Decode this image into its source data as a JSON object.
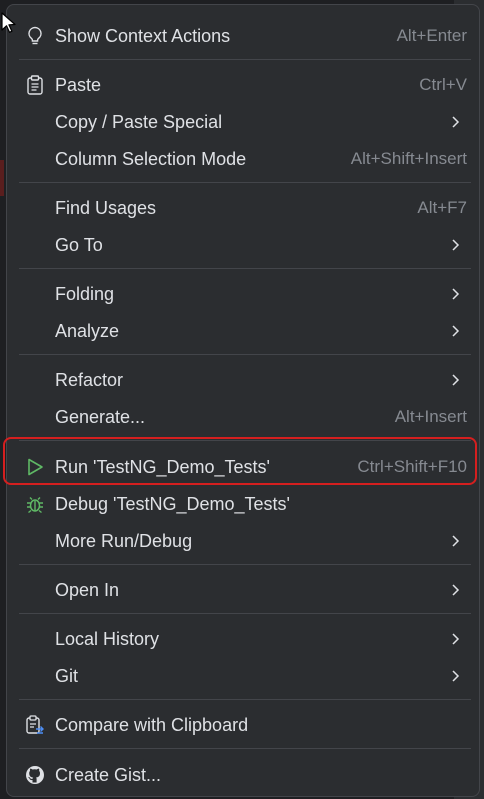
{
  "menu": {
    "items": [
      {
        "label": "Show Context Actions",
        "shortcut": "Alt+Enter",
        "icon": "lightbulb-icon"
      },
      {
        "label": "Paste",
        "shortcut": "Ctrl+V",
        "icon": "clipboard-icon"
      },
      {
        "label": "Copy / Paste Special",
        "submenu": true
      },
      {
        "label": "Column Selection Mode",
        "shortcut": "Alt+Shift+Insert"
      },
      {
        "label": "Find Usages",
        "shortcut": "Alt+F7"
      },
      {
        "label": "Go To",
        "submenu": true
      },
      {
        "label": "Folding",
        "submenu": true
      },
      {
        "label": "Analyze",
        "submenu": true
      },
      {
        "label": "Refactor",
        "submenu": true
      },
      {
        "label": "Generate...",
        "shortcut": "Alt+Insert"
      },
      {
        "label": "Run 'TestNG_Demo_Tests'",
        "shortcut": "Ctrl+Shift+F10",
        "icon": "run-icon"
      },
      {
        "label": "Debug 'TestNG_Demo_Tests'",
        "icon": "debug-icon"
      },
      {
        "label": "More Run/Debug",
        "submenu": true
      },
      {
        "label": "Open In",
        "submenu": true
      },
      {
        "label": "Local History",
        "submenu": true
      },
      {
        "label": "Git",
        "submenu": true
      },
      {
        "label": "Compare with Clipboard",
        "icon": "compare-clipboard-icon"
      },
      {
        "label": "Create Gist...",
        "icon": "github-icon"
      }
    ]
  },
  "colors": {
    "background": "#2b2d30",
    "text": "#dfe1e5",
    "shortcut": "#868a91",
    "highlight_border": "#d51f1f",
    "run_icon": "#5fb865",
    "debug_icon": "#5fb865"
  }
}
